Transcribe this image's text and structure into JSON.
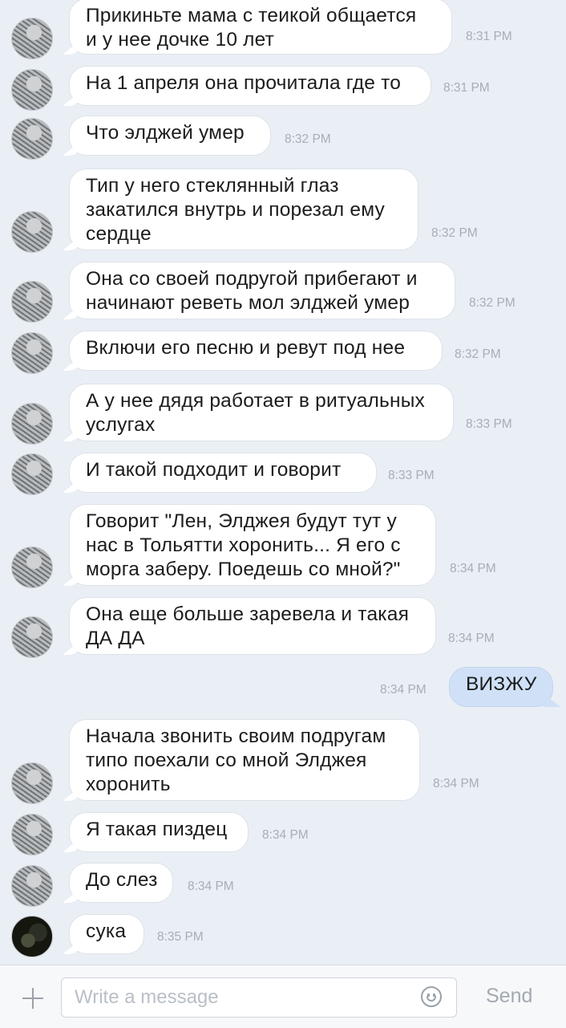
{
  "messages": [
    {
      "lines": [
        "Прикиньте мама с теикой общается",
        "и у нее дочке 10 лет"
      ],
      "time": "8:31 PM"
    },
    {
      "lines": [
        "На 1 апреля она прочитала где то"
      ],
      "time": "8:31 PM"
    },
    {
      "lines": [
        "Что элджей умер"
      ],
      "time": "8:32 PM"
    },
    {
      "lines": [
        "Тип у него стеклянный глаз",
        "закатился внутрь и порезал ему",
        "сердце"
      ],
      "time": "8:32 PM"
    },
    {
      "lines": [
        "Она со своей подругой прибегают и",
        "начинают реветь мол элджей умер"
      ],
      "time": "8:32 PM"
    },
    {
      "lines": [
        "Включи его песню и ревут под нее"
      ],
      "time": "8:32 PM"
    },
    {
      "lines": [
        "А у нее дядя работает в ритуальных",
        "услугах"
      ],
      "time": "8:33 PM"
    },
    {
      "lines": [
        "И такой подходит и говорит"
      ],
      "time": "8:33 PM"
    },
    {
      "lines": [
        "Говорит \"Лен, Элджея будут тут у",
        "нас в Тольятти хоронить... Я его с",
        "морга заберу. Поедешь со мной?\""
      ],
      "time": "8:34 PM"
    },
    {
      "lines": [
        "Она еще больше заревела и такая",
        "ДА ДА"
      ],
      "time": "8:34 PM"
    },
    {
      "lines": [
        "ВИЗЖУ"
      ],
      "time": "8:34 PM",
      "outgoing": true
    },
    {
      "lines": [
        "Начала звонить своим подругам",
        "типо поехали со мной Элджея",
        "хоронить"
      ],
      "time": "8:34 PM"
    },
    {
      "lines": [
        "Я такая пиздец"
      ],
      "time": "8:34 PM"
    },
    {
      "lines": [
        "До слез"
      ],
      "time": "8:34 PM"
    },
    {
      "lines": [
        "сука"
      ],
      "time": "8:35 PM"
    }
  ],
  "composer": {
    "placeholder": "Write a message",
    "send_label": "Send",
    "attach_icon": "plus-icon",
    "emoji_icon": "smile-icon"
  },
  "colors": {
    "background": "#eaeff5",
    "incoming_bubble": "#ffffff",
    "outgoing_bubble": "#cfe0f7",
    "timestamp": "#a7aeb6"
  }
}
